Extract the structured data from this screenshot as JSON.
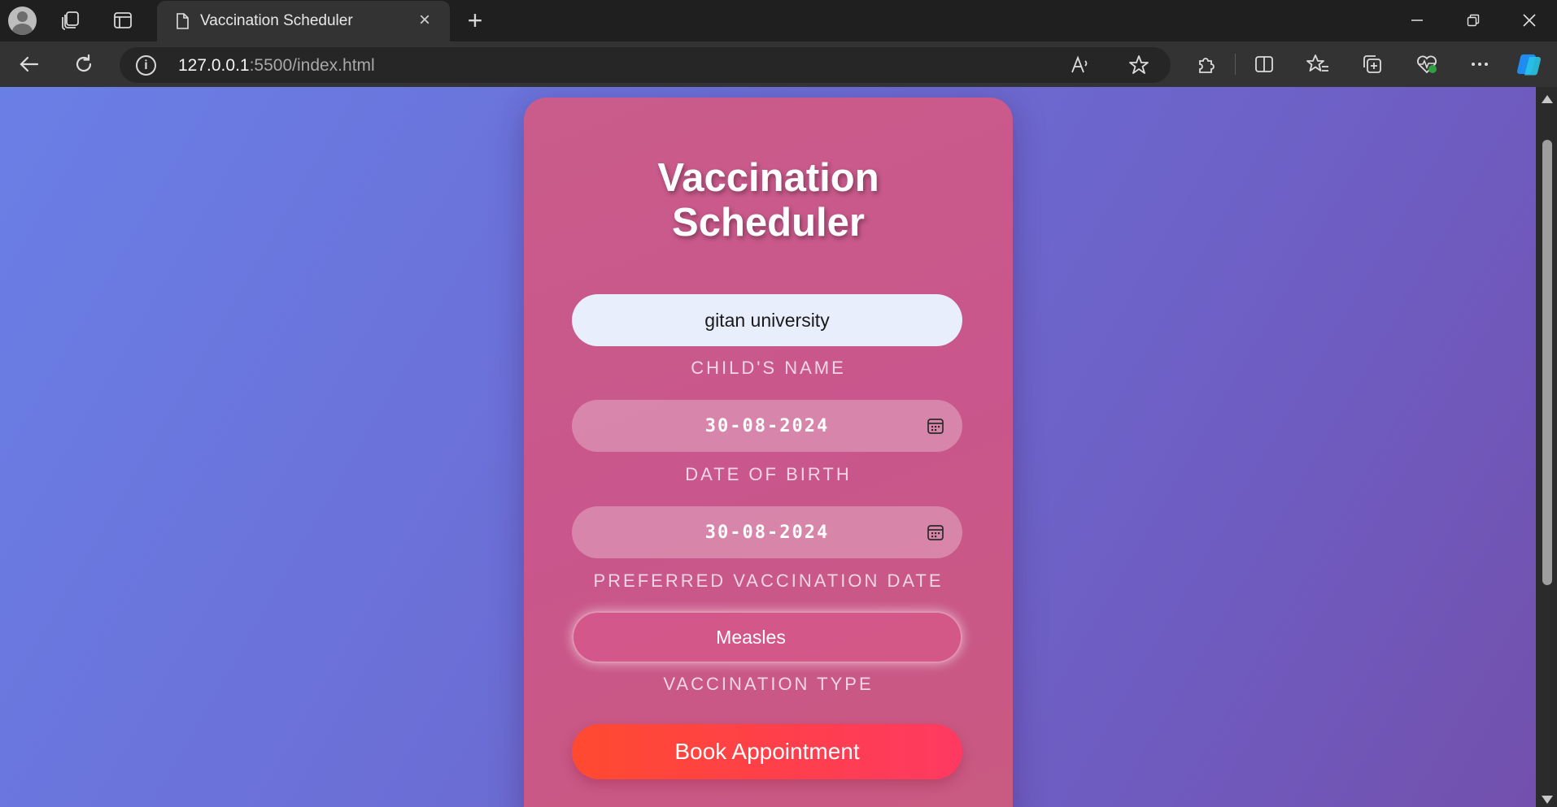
{
  "browser": {
    "tab_title": "Vaccination Scheduler",
    "url_host": "127.0.0.1",
    "url_rest": ":5500/index.html",
    "new_tab_symbol": "+",
    "tab_close_symbol": "×",
    "info_symbol": "i"
  },
  "page": {
    "title_line1": "Vaccination",
    "title_line2": "Scheduler",
    "child_name": {
      "value": "gitan university",
      "label": "CHILD'S NAME"
    },
    "date_of_birth": {
      "value": "30-08-2024",
      "label": "DATE OF BIRTH"
    },
    "preferred_date": {
      "value": "30-08-2024",
      "label": "PREFERRED VACCINATION DATE"
    },
    "vaccination_type": {
      "value": "Measles",
      "label": "VACCINATION TYPE"
    },
    "submit_label": "Book Appointment"
  },
  "colors": {
    "background_start": "#6a7fe6",
    "background_end": "#7350ad",
    "card": "#c9568c",
    "button_start": "#ff4a30",
    "button_end": "#ff3a62",
    "name_field": "#e8eefb"
  },
  "icons": [
    "profile-icon",
    "workspaces-icon",
    "tab-actions-icon",
    "page-icon",
    "close-icon",
    "new-tab-icon",
    "minimize-icon",
    "restore-icon",
    "back-icon",
    "refresh-icon",
    "info-icon",
    "read-aloud-icon",
    "favorite-star-icon",
    "extensions-icon",
    "split-screen-icon",
    "favorites-icon",
    "collections-icon",
    "browser-essentials-icon",
    "more-icon",
    "copilot-icon",
    "calendar-icon"
  ]
}
